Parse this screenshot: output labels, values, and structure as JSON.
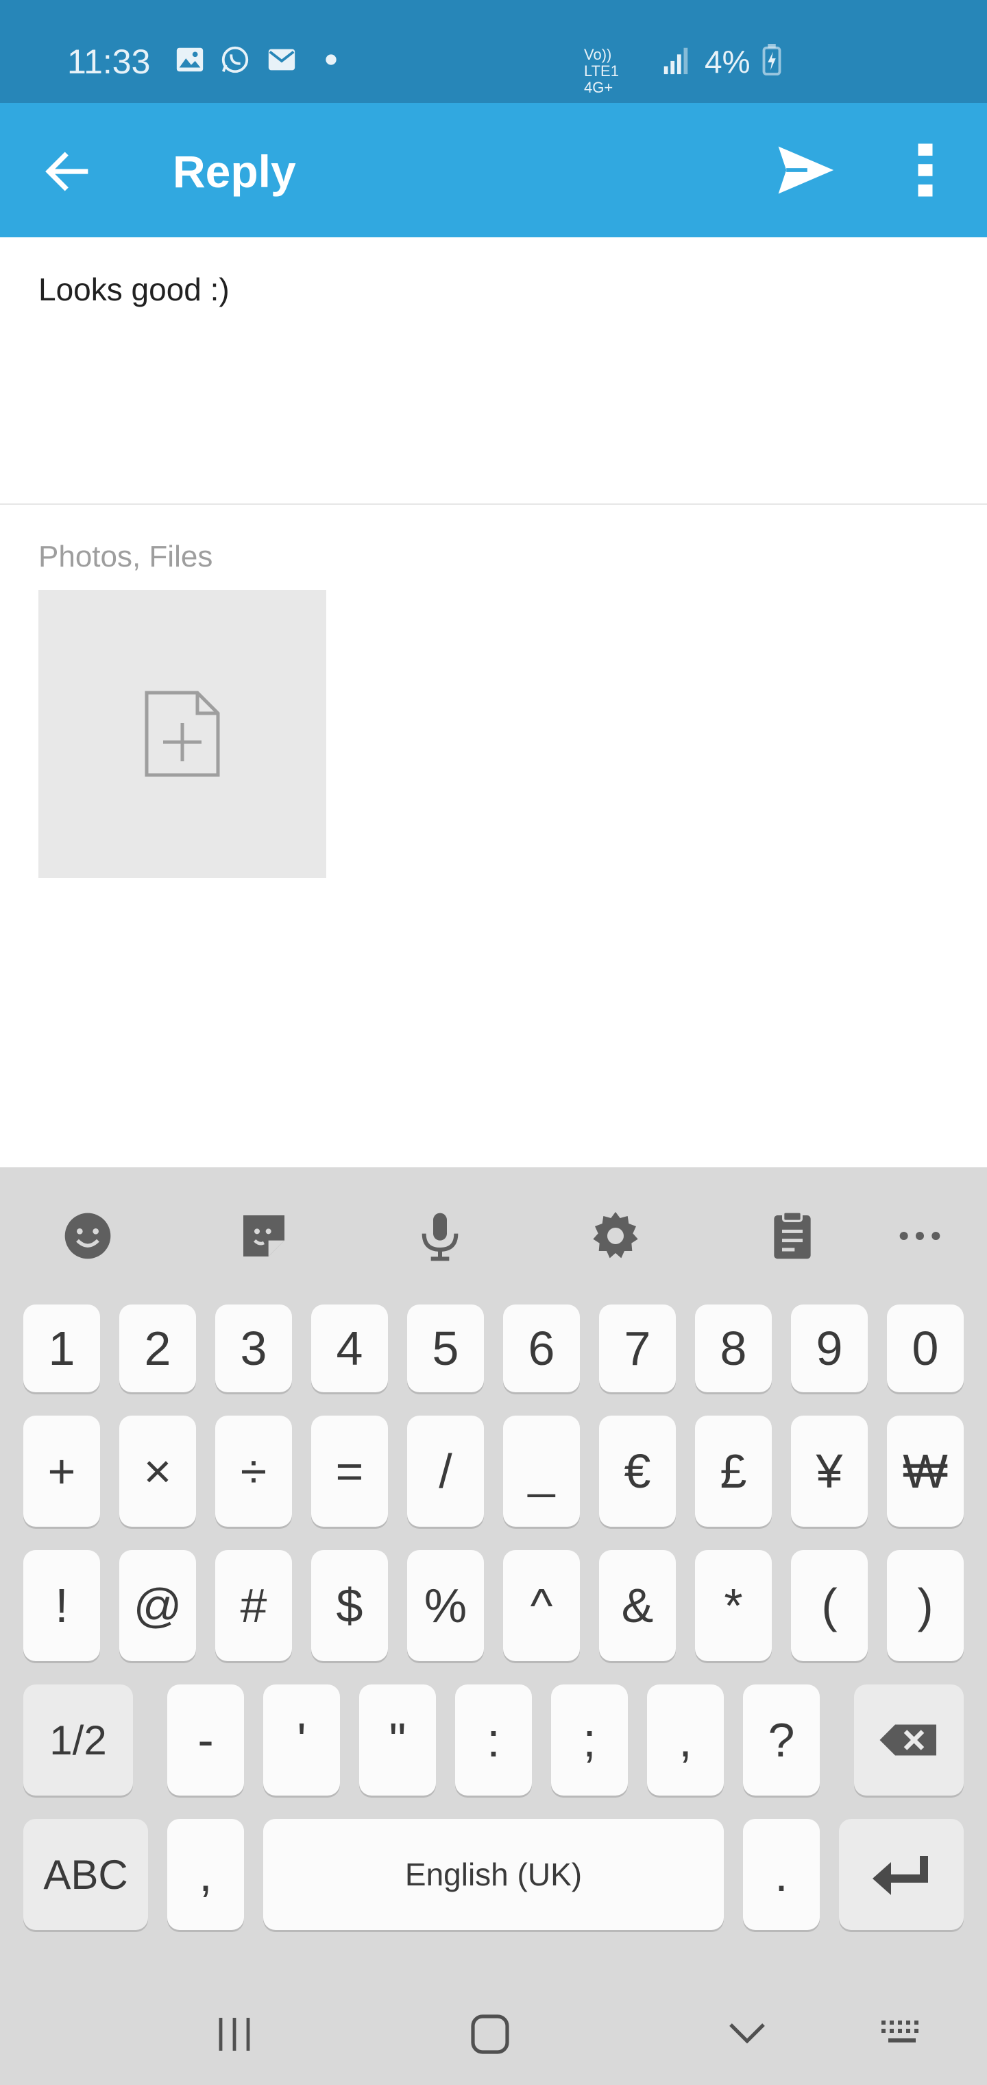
{
  "status_bar": {
    "time": "11:33",
    "network_label": "Vo)) LTE1 4G+",
    "battery": "4%"
  },
  "app_bar": {
    "title": "Reply",
    "back_icon": "arrow-left-icon",
    "send_icon": "send-icon",
    "more_icon": "more-vert-icon"
  },
  "compose": {
    "message": "Looks good :)",
    "attachments_label": "Photos, Files"
  },
  "keyboard": {
    "toolbar": [
      "emoji-icon",
      "sticker-icon",
      "microphone-icon",
      "settings-icon",
      "clipboard-icon",
      "more-horiz-icon"
    ],
    "row1": [
      "1",
      "2",
      "3",
      "4",
      "5",
      "6",
      "7",
      "8",
      "9",
      "0"
    ],
    "row2": [
      "+",
      "×",
      "÷",
      "=",
      "/",
      "_",
      "€",
      "£",
      "¥",
      "₩"
    ],
    "row3": [
      "!",
      "@",
      "#",
      "$",
      "%",
      "^",
      "&",
      "*",
      "(",
      ")"
    ],
    "row4": [
      "1/2",
      "-",
      "'",
      "\"",
      ":",
      ";",
      ",",
      "?"
    ],
    "row5": {
      "abc": "ABC",
      "comma": ",",
      "space": "English (UK)",
      "period": "."
    }
  },
  "colors": {
    "status_bar": "#2786b8",
    "app_bar": "#31a8e0",
    "keyboard_bg": "#d9d9d9"
  }
}
